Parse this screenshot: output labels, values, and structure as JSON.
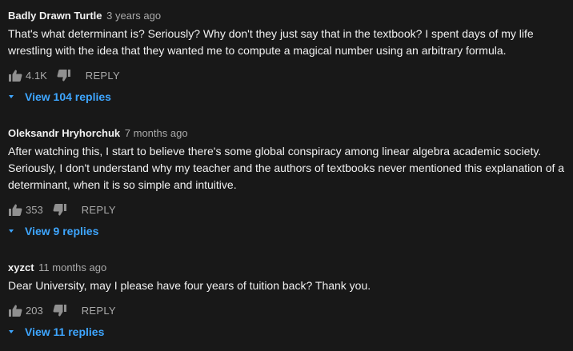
{
  "comments": [
    {
      "author": "Badly Drawn Turtle",
      "time": "3 years ago",
      "text": "That's what determinant is? Seriously? Why don't they just say that in the textbook? I spent days of my life wrestling with the idea that they wanted me to compute a magical number using an arbitrary formula.",
      "likes": "4.1K",
      "reply_label": "REPLY",
      "view_replies": "View 104 replies"
    },
    {
      "author": "Oleksandr Hryhorchuk",
      "time": "7 months ago",
      "text": "After watching this, I start to believe there's some global conspiracy among linear algebra academic society. Seriously, I don't understand why my teacher and the authors of textbooks never mentioned this explanation of a determinant, when it is so simple and intuitive.",
      "likes": "353",
      "reply_label": "REPLY",
      "view_replies": "View 9 replies"
    },
    {
      "author": "xyzct",
      "time": "11 months ago",
      "text": "Dear University, may I please have four years of tuition back? Thank you.",
      "likes": "203",
      "reply_label": "REPLY",
      "view_replies": "View 11 replies"
    }
  ],
  "icons": {
    "like": "thumbs-up-icon",
    "dislike": "thumbs-down-icon",
    "expand": "caret-down-icon"
  },
  "colors": {
    "background": "#181818",
    "text": "#f1f1f1",
    "secondary_text": "#aaaaaa",
    "link": "#3ea6ff"
  }
}
